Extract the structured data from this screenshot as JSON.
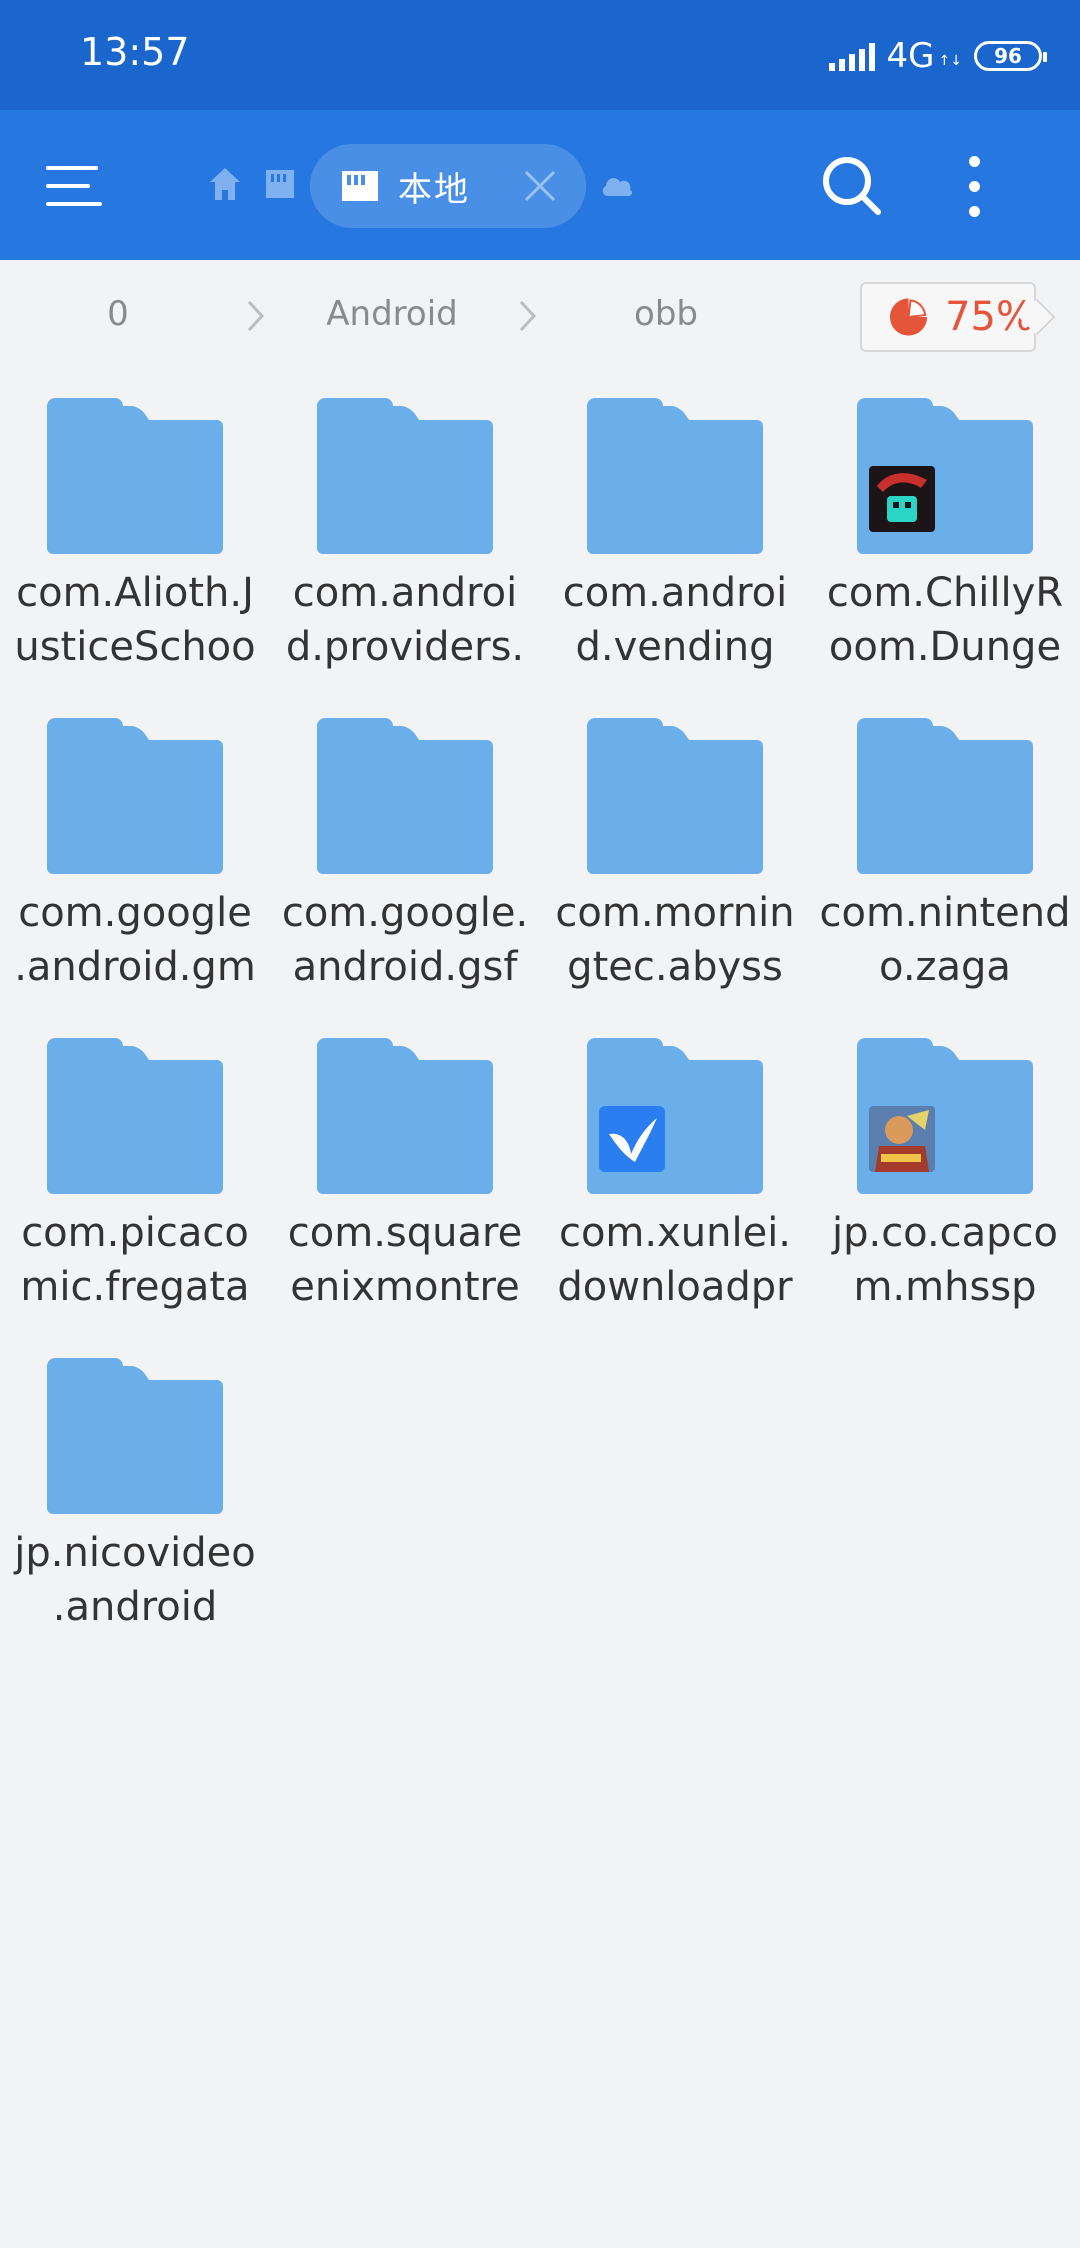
{
  "status_bar": {
    "time": "13:57",
    "network": "4G",
    "battery": "96"
  },
  "toolbar": {
    "menu_icon": "hamburger-menu-icon",
    "tab_label": "本地",
    "icons": [
      "home-icon",
      "sd-card-icon",
      "close-icon",
      "cloud-icon",
      "search-icon",
      "more-vertical-icon"
    ]
  },
  "breadcrumb": {
    "items": [
      "0",
      "Android",
      "obb"
    ],
    "storage_percent": "75%"
  },
  "colors": {
    "status_bar": "#1a66cc",
    "toolbar": "#2777e0",
    "folder": "#6aafe9",
    "storage_accent": "#e4553a"
  },
  "folders": [
    {
      "line1": "com.Alioth.J",
      "line2": "usticeSchoo",
      "badge": null
    },
    {
      "line1": "com.androi",
      "line2": "d.providers.",
      "badge": null
    },
    {
      "line1": "com.androi",
      "line2": "d.vending",
      "badge": null
    },
    {
      "line1": "com.ChillyR",
      "line2": "oom.Dunge",
      "badge": "soul-knight-app-icon"
    },
    {
      "line1": "com.google",
      "line2": ".android.gm",
      "badge": null
    },
    {
      "line1": "com.google.",
      "line2": "android.gsf",
      "badge": null
    },
    {
      "line1": "com.mornin",
      "line2": "gtec.abyss",
      "badge": null
    },
    {
      "line1": "com.nintend",
      "line2": "o.zaga",
      "badge": null
    },
    {
      "line1": "com.picaco",
      "line2": "mic.fregata",
      "badge": null
    },
    {
      "line1": "com.square",
      "line2": "enixmontre",
      "badge": null
    },
    {
      "line1": "com.xunlei.",
      "line2": "downloadpr",
      "badge": "xunlei-bird-app-icon"
    },
    {
      "line1": "jp.co.capco",
      "line2": "m.mhssp",
      "badge": "monster-hunter-app-icon"
    },
    {
      "line1": "jp.nicovideo",
      "line2": ".android",
      "badge": null
    }
  ]
}
